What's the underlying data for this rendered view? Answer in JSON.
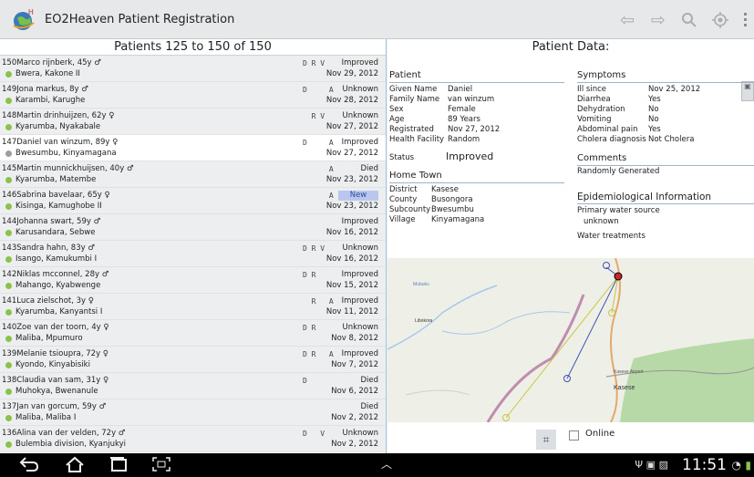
{
  "app": {
    "title": "EO2Heaven Patient Registration",
    "logo_text": "H"
  },
  "actionbar": {
    "icons": [
      "back-arrow-icon",
      "forward-arrow-icon",
      "search-icon",
      "locate-icon",
      "overflow-menu-icon"
    ]
  },
  "list": {
    "header": "Patients 125 to 150 of 150",
    "rows": [
      {
        "num": "150",
        "name": "Marco rijnberk, 45y ♂",
        "loc": "Bwera, Kakone II",
        "flags": "D R V",
        "status": "Improved",
        "date": "Nov 29, 2012",
        "dot": "green"
      },
      {
        "num": "149",
        "name": "Jona markus, 8y ♂",
        "loc": "Karambi, Karughe",
        "flags": "D     A",
        "status": "Unknown",
        "date": "Nov 28, 2012",
        "dot": "green"
      },
      {
        "num": "148",
        "name": "Martin drinhuijzen, 62y ♀",
        "loc": "Kyarumba, Nyakabale",
        "flags": "  R V",
        "status": "Unknown",
        "date": "Nov 27, 2012",
        "dot": "green"
      },
      {
        "num": "147",
        "name": "Daniel van winzum, 89y ♀",
        "loc": "Bwesumbu, Kinyamagana",
        "flags": "D     A",
        "status": "Improved",
        "date": "Nov 27, 2012",
        "dot": "gray",
        "selected": true
      },
      {
        "num": "145",
        "name": "Martin munnickhuijsen, 40y ♂",
        "loc": "Kyarumba, Matembe",
        "flags": "      A",
        "status": "Died",
        "date": "Nov 23, 2012",
        "dot": "green"
      },
      {
        "num": "146",
        "name": "Sabrina bavelaar, 65y ♀",
        "loc": "Kisinga, Kamughobe II",
        "flags": "      A",
        "status": "New",
        "date": "Nov 23, 2012",
        "dot": "green",
        "is_new": true
      },
      {
        "num": "144",
        "name": "Johanna swart, 59y ♂",
        "loc": "Karusandara, Sebwe",
        "flags": "",
        "status": "Improved",
        "date": "Nov 16, 2012",
        "dot": "green"
      },
      {
        "num": "143",
        "name": "Sandra hahn, 83y ♂",
        "loc": "Isango, Kamukumbi I",
        "flags": "D R V",
        "status": "Unknown",
        "date": "Nov 16, 2012",
        "dot": "green"
      },
      {
        "num": "142",
        "name": "Niklas mcconnel, 28y ♂",
        "loc": "Mahango, Kyabwenge",
        "flags": "D R",
        "status": "Improved",
        "date": "Nov 15, 2012",
        "dot": "green"
      },
      {
        "num": "141",
        "name": "Luca zielschot, 3y ♀",
        "loc": "Kyarumba, Kanyantsi I",
        "flags": "  R   A",
        "status": "Improved",
        "date": "Nov 11, 2012",
        "dot": "green"
      },
      {
        "num": "140",
        "name": "Zoe van der toorn, 4y ♀",
        "loc": "Maliba, Mpumuro",
        "flags": "D R",
        "status": "Unknown",
        "date": "Nov 8, 2012",
        "dot": "green"
      },
      {
        "num": "139",
        "name": "Melanie tsioupra, 72y ♀",
        "loc": "Kyondo, Kinyabisiki",
        "flags": "D R   A",
        "status": "Improved",
        "date": "Nov 7, 2012",
        "dot": "green"
      },
      {
        "num": "138",
        "name": "Claudia van sam, 31y ♀",
        "loc": "Muhokya, Bwenanule",
        "flags": "D",
        "status": "Died",
        "date": "Nov 6, 2012",
        "dot": "green"
      },
      {
        "num": "137",
        "name": "Jan van gorcum, 59y ♂",
        "loc": "Maliba, Maliba I",
        "flags": "",
        "status": "Died",
        "date": "Nov 2, 2012",
        "dot": "green"
      },
      {
        "num": "136",
        "name": "Alina van der velden, 72y ♂",
        "loc": "Bulembia division, Kyanjukyi",
        "flags": "D   V",
        "status": "Unknown",
        "date": "Nov 2, 2012",
        "dot": "green"
      }
    ]
  },
  "detail": {
    "header": "Patient Data:",
    "patient": {
      "title": "Patient",
      "fields": [
        {
          "k": "Given Name",
          "v": "Daniel"
        },
        {
          "k": "Family Name",
          "v": "van winzum"
        },
        {
          "k": "Sex",
          "v": "Female"
        },
        {
          "k": "Age",
          "v": "89 Years"
        },
        {
          "k": "Registrated",
          "v": "Nov 27, 2012"
        },
        {
          "k": "Health Facility",
          "v": "Random"
        }
      ],
      "status_label": "Status",
      "status_value": "Improved"
    },
    "hometown": {
      "title": "Home Town",
      "fields": [
        {
          "k": "District",
          "v": "Kasese"
        },
        {
          "k": "County",
          "v": "Busongora"
        },
        {
          "k": "Subcounty",
          "v": "Bwesumbu"
        },
        {
          "k": "Village",
          "v": "Kinyamagana"
        }
      ]
    },
    "symptoms": {
      "title": "Symptoms",
      "fields": [
        {
          "k": "Ill since",
          "v": "Nov 25, 2012"
        },
        {
          "k": "Diarrhea",
          "v": "Yes"
        },
        {
          "k": "Dehydration",
          "v": "No"
        },
        {
          "k": "Vomiting",
          "v": "No"
        },
        {
          "k": "Abdominal pain",
          "v": "Yes"
        },
        {
          "k": "Cholera diagnosis",
          "v": "Not Cholera"
        }
      ]
    },
    "comments": {
      "title": "Comments",
      "text": "Randomly Generated"
    },
    "epi": {
      "title": "Epidemiological Information",
      "water_source_label": "Primary water source",
      "water_source_value": "unknown",
      "treatments_label": "Water treatments"
    },
    "map_labels": {
      "a": "Mubuku",
      "b": "Kasese",
      "c": "Kasese Airport",
      "d": "Libokora"
    },
    "online_label": "Online"
  },
  "statusbar": {
    "time": "11:51"
  },
  "colors": {
    "accent": "#9fc6dd",
    "new_badge": "#b9c7ef",
    "green_dot": "#8bc34a"
  }
}
